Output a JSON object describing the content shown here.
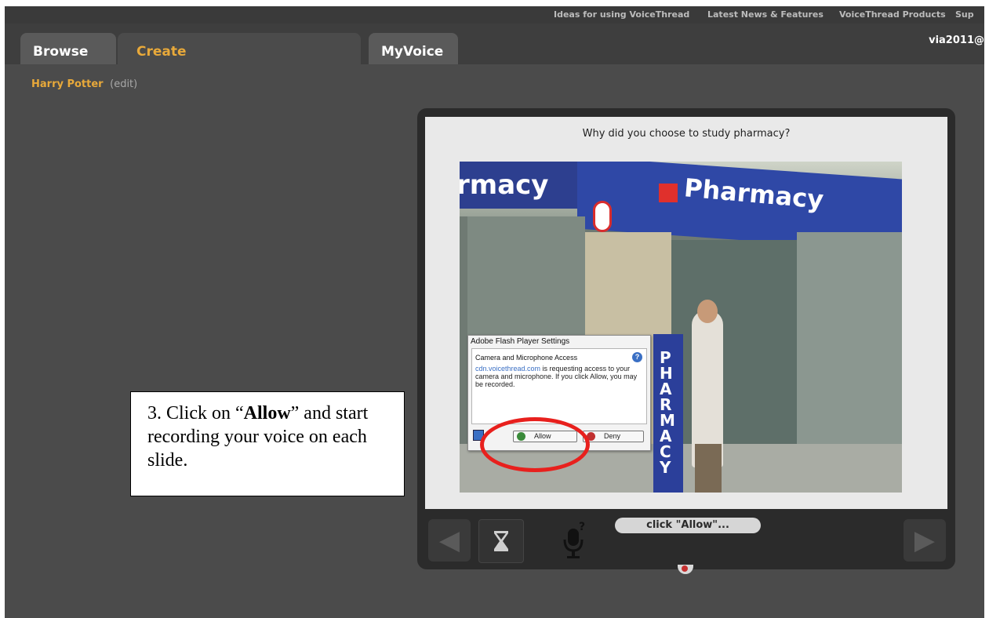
{
  "toplinks": [
    "Ideas for using VoiceThread",
    "Latest News & Features",
    "VoiceThread Products",
    "Sup"
  ],
  "tabs": {
    "browse": "Browse",
    "create": "Create",
    "myvoice": "MyVoice"
  },
  "user": "via2011@",
  "breadcrumb": {
    "title": "Harry Potter",
    "edit": "(edit)"
  },
  "slide": {
    "question": "Why did you choose to study pharmacy?"
  },
  "flash_dialog": {
    "title": "Adobe Flash Player Settings",
    "heading": "Camera and Microphone Access",
    "help_icon": "?",
    "domain": "cdn.voicethread.com",
    "message": " is requesting access to your camera and microphone. If you click Allow, you may be recorded.",
    "allow": "Allow",
    "deny": "Deny"
  },
  "controls": {
    "status": "click \"Allow\"...",
    "prev_icon": "arrow-left-icon",
    "next_icon": "arrow-right-icon",
    "timer_icon": "hourglass-icon",
    "mic_icon": "microphone-icon"
  },
  "instruction": {
    "prefix": "3. Click on “",
    "bold": "Allow",
    "suffix": "” and start recording your voice on each slide."
  },
  "photo_sign": {
    "left": "rmacy",
    "right": "Pharmacy",
    "vertical": "PHARMACY"
  },
  "colors": {
    "accent": "#e8a93a",
    "highlight": "#e8201d",
    "player_bg": "#2b2b2b",
    "page_bg": "#4b4b4b"
  }
}
